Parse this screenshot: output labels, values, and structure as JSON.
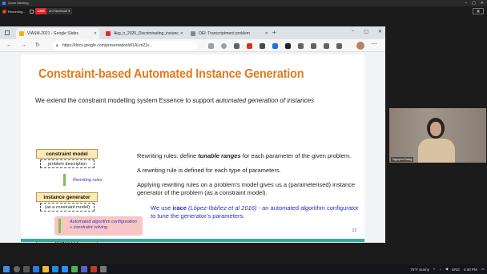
{
  "zoom": {
    "title": "Zoom Meeting",
    "recording": "Recording...",
    "live_badge": "LIVE",
    "live_target": "on Facebook",
    "participant_name": "Nguyen Dang"
  },
  "browser": {
    "tabs": [
      {
        "label": "VIASM-2021 - Google Slides",
        "icon": "slides-icon",
        "active": true
      },
      {
        "label": "Akg_n_2020_Discriminating_instanc",
        "icon": "pdf-icon",
        "active": false
      },
      {
        "label": "OEI: Transcriptment problem",
        "icon": "doc-icon",
        "active": false
      }
    ],
    "url": "https://docs.google.com/presentation/d/1ALm21v..."
  },
  "slide": {
    "title": "Constraint-based Automated Instance Generation",
    "intro_plain": "We extend the constraint modelling system Essence to support ",
    "intro_italic": "automated generation of instances",
    "diagram": {
      "box1": "constraint model",
      "sub1": "problem description",
      "arrow1": "Rewriting rules",
      "box2": "instance generator",
      "sub2": "(as a constraint model)",
      "pink_line1": "Automated algorithm configuration",
      "pink_line2": "+ constraint solving",
      "box3": "instances"
    },
    "bullets": {
      "b1_pre": "Rewriting rules: define ",
      "b1_em": "tunable ranges",
      "b1_post": " for each parameter of the given problem.",
      "b2": "A rewriting rule is defined for each type of parameters.",
      "b3": "Applying rewriting rules on a problem’s model gives us a (parameterised) instance generator of the problem (as a constraint model).",
      "b4_pre": "We use ",
      "b4_irace": "irace",
      "b4_ref": " (López-Ibáñez et al 2016)",
      "b4_post": " - an automated algorithm configurator to tune the generator’s parameters."
    },
    "page_number": "13"
  },
  "taskbar": {
    "weather": "75°F Sunny",
    "language": "ENG",
    "time": "4:40 PM"
  },
  "colors": {
    "title_orange": "#e07b1a",
    "footer_teal": "#3aa8a0",
    "box_fill": "#fde8b8",
    "arrow_green": "#7cc24f",
    "pink_fill": "#f7c6c6",
    "link_blue": "#1b2fd1",
    "live_red": "#e0242a"
  }
}
